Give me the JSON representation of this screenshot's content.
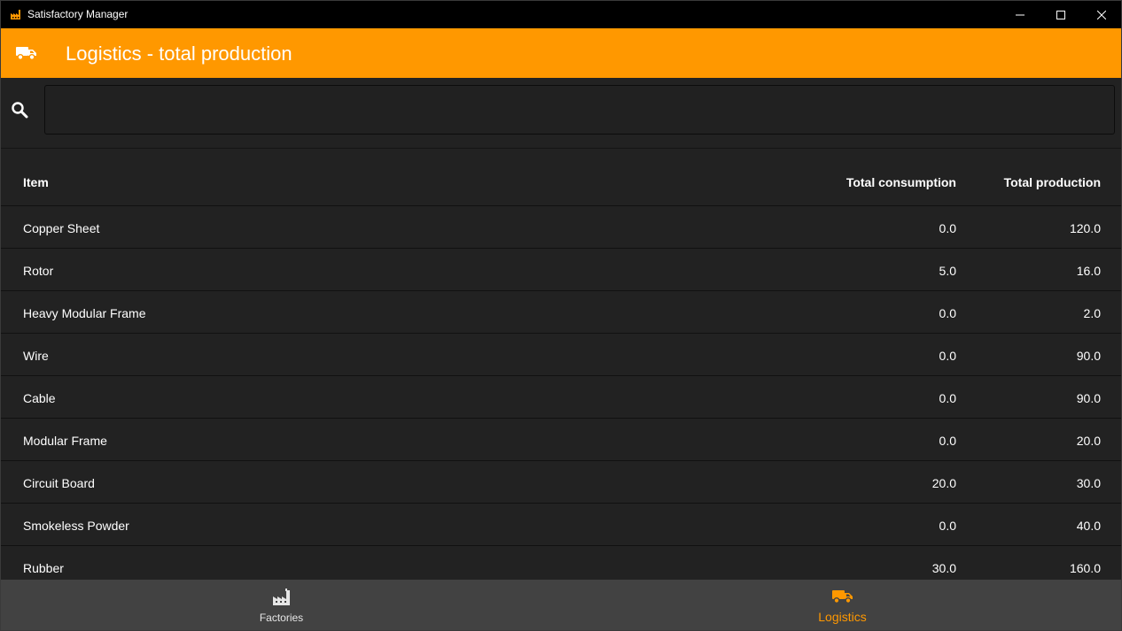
{
  "window": {
    "title": "Satisfactory Manager",
    "app_icon": "factory-icon",
    "controls": [
      "minimize-icon",
      "maximize-icon",
      "close-icon"
    ]
  },
  "appbar": {
    "icon": "truck-icon",
    "title": "Logistics - total production",
    "color": "#ff9800"
  },
  "search": {
    "icon": "search-icon",
    "value": "",
    "placeholder": ""
  },
  "table": {
    "headers": {
      "item": "Item",
      "consumption": "Total consumption",
      "production": "Total production"
    },
    "rows": [
      {
        "item": "Copper Sheet",
        "consumption": "0.0",
        "production": "120.0"
      },
      {
        "item": "Rotor",
        "consumption": "5.0",
        "production": "16.0"
      },
      {
        "item": "Heavy Modular Frame",
        "consumption": "0.0",
        "production": "2.0"
      },
      {
        "item": "Wire",
        "consumption": "0.0",
        "production": "90.0"
      },
      {
        "item": "Cable",
        "consumption": "0.0",
        "production": "90.0"
      },
      {
        "item": "Modular Frame",
        "consumption": "0.0",
        "production": "20.0"
      },
      {
        "item": "Circuit Board",
        "consumption": "20.0",
        "production": "30.0"
      },
      {
        "item": "Smokeless Powder",
        "consumption": "0.0",
        "production": "40.0"
      },
      {
        "item": "Rubber",
        "consumption": "30.0",
        "production": "160.0"
      }
    ]
  },
  "bottom_nav": {
    "tabs": [
      {
        "label": "Factories",
        "icon": "factory-icon",
        "active": false
      },
      {
        "label": "Logistics",
        "icon": "truck-icon",
        "active": true
      }
    ],
    "active_color": "#ff9800"
  }
}
